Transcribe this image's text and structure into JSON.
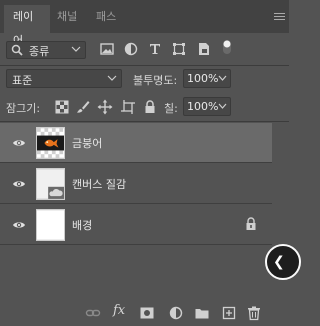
{
  "tabs": [
    {
      "label": "레이어",
      "active": true
    },
    {
      "label": "채널",
      "active": false
    },
    {
      "label": "패스",
      "active": false
    }
  ],
  "filter": {
    "kind_label": "종류"
  },
  "blend": {
    "mode": "표준",
    "opacity_label": "불투명도:",
    "opacity_value": "100%"
  },
  "lock_row": {
    "lock_label": "잠그기:",
    "fill_label": "칠:",
    "fill_value": "100%"
  },
  "layers": [
    {
      "name": "금붕어",
      "selected": true,
      "visible": true,
      "thumb": "goldfish",
      "locked": false
    },
    {
      "name": "캔버스 질감",
      "selected": false,
      "visible": true,
      "thumb": "canvas-texture",
      "locked": false
    },
    {
      "name": "배경",
      "selected": false,
      "visible": true,
      "thumb": "white",
      "locked": true
    }
  ],
  "colors": {
    "panel_bg": "#535353",
    "tab_bar_bg": "#424242",
    "selected_row": "#6a6a6a"
  }
}
